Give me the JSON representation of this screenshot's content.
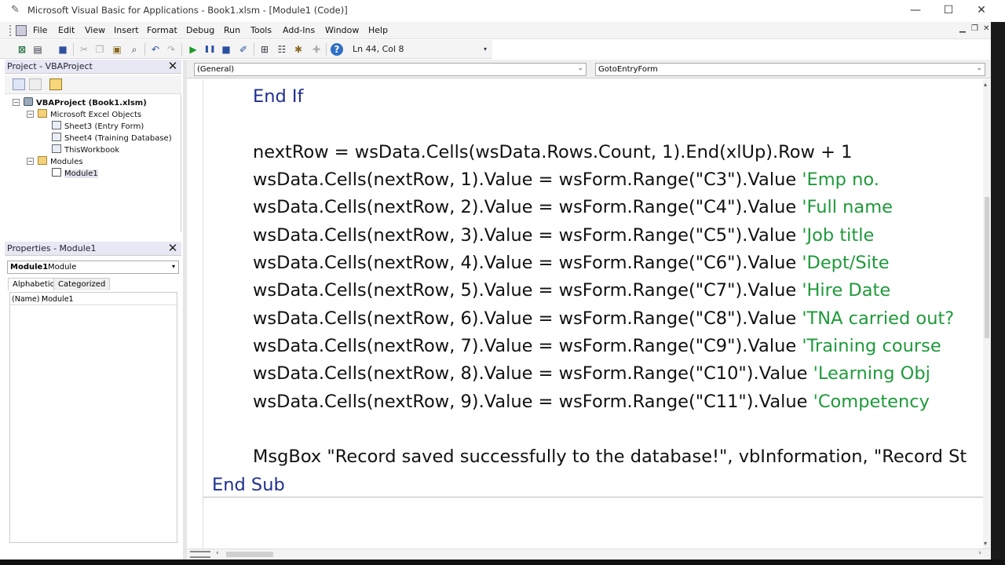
{
  "window": {
    "title": "Microsoft Visual Basic for Applications - Book1.xlsm - [Module1 (Code)]",
    "minimize": "—",
    "maximize": "☐",
    "close": "✕"
  },
  "menu": {
    "items": [
      "File",
      "Edit",
      "View",
      "Insert",
      "Format",
      "Debug",
      "Run",
      "Tools",
      "Add-Ins",
      "Window",
      "Help"
    ],
    "mdi_minimize": "▁",
    "mdi_restore": "❐",
    "mdi_close": "✕"
  },
  "toolbar": {
    "position": "Ln 44, Col 8",
    "icons": [
      "excel-icon",
      "insert-userform-icon",
      "save-icon",
      "cut-icon",
      "copy-icon",
      "paste-icon",
      "find-icon",
      "undo-icon",
      "redo-icon",
      "run-icon",
      "break-icon",
      "reset-icon",
      "design-mode-icon",
      "project-explorer-icon",
      "properties-window-icon",
      "object-browser-icon",
      "toolbox-icon",
      "help-icon"
    ]
  },
  "project_panel": {
    "title": "Project - VBAProject",
    "close": "✕",
    "tree": [
      {
        "label": "VBAProject (Book1.xlsm)",
        "icon": "project-icon"
      },
      {
        "label": "Microsoft Excel Objects",
        "icon": "folder-icon"
      },
      {
        "label": "Sheet3 (Entry Form)",
        "icon": "worksheet-icon"
      },
      {
        "label": "Sheet4 (Training Database)",
        "icon": "worksheet-icon"
      },
      {
        "label": "ThisWorkbook",
        "icon": "workbook-icon"
      },
      {
        "label": "Modules",
        "icon": "folder-icon"
      },
      {
        "label": "Module1",
        "icon": "module-icon"
      }
    ]
  },
  "properties_panel": {
    "title": "Properties - Module1",
    "close": "✕",
    "object_name": "Module1",
    "object_type": "Module",
    "tabs": [
      "Alphabetic",
      "Categorized"
    ],
    "rows": [
      {
        "key": "(Name)",
        "value": "Module1"
      }
    ]
  },
  "code_window": {
    "object_combo": "(General)",
    "procedure_combo": "GotoEntryForm",
    "lines": {
      "l1": "End If",
      "l2": "nextRow = wsData.Cells(wsData.Rows.Count, 1).End(xlUp).Row + 1",
      "l3_code": "wsData.Cells(nextRow, 1).Value = wsForm.Range(\"C3\").Value ",
      "l3_comment": "'Emp no.",
      "l4_code": "wsData.Cells(nextRow, 2).Value = wsForm.Range(\"C4\").Value ",
      "l4_comment": "'Full name",
      "l5_code": "wsData.Cells(nextRow, 3).Value = wsForm.Range(\"C5\").Value ",
      "l5_comment": "'Job title",
      "l6_code": "wsData.Cells(nextRow, 4).Value = wsForm.Range(\"C6\").Value ",
      "l6_comment": "'Dept/Site",
      "l7_code": "wsData.Cells(nextRow, 5).Value = wsForm.Range(\"C7\").Value ",
      "l7_comment": "'Hire Date",
      "l8_code": "wsData.Cells(nextRow, 6).Value = wsForm.Range(\"C8\").Value ",
      "l8_comment": "'TNA carried out?",
      "l9_code": "wsData.Cells(nextRow, 7).Value = wsForm.Range(\"C9\").Value ",
      "l9_comment": "'Training course",
      "l10_code": "wsData.Cells(nextRow, 8).Value = wsForm.Range(\"C10\").Value ",
      "l10_comment": "'Learning Obj",
      "l11_code": "wsData.Cells(nextRow, 9).Value = wsForm.Range(\"C11\").Value ",
      "l11_comment": "'Competency",
      "l12": "MsgBox \"Record saved successfully to the database!\", vbInformation, \"Record St",
      "l13": "End Sub"
    }
  },
  "colors": {
    "keyword": "#1f2f8f",
    "comment": "#1e9a3a",
    "code_text": "#111111"
  }
}
